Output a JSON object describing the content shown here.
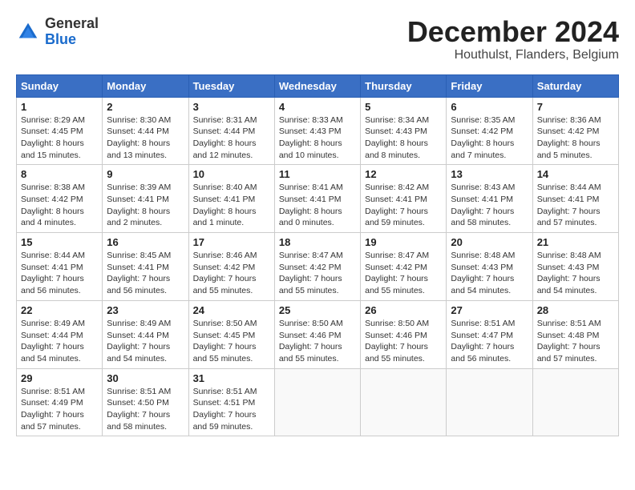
{
  "header": {
    "logo_general": "General",
    "logo_blue": "Blue",
    "month_title": "December 2024",
    "subtitle": "Houthulst, Flanders, Belgium"
  },
  "weekdays": [
    "Sunday",
    "Monday",
    "Tuesday",
    "Wednesday",
    "Thursday",
    "Friday",
    "Saturday"
  ],
  "weeks": [
    [
      {
        "day": "1",
        "info": "Sunrise: 8:29 AM\nSunset: 4:45 PM\nDaylight: 8 hours\nand 15 minutes."
      },
      {
        "day": "2",
        "info": "Sunrise: 8:30 AM\nSunset: 4:44 PM\nDaylight: 8 hours\nand 13 minutes."
      },
      {
        "day": "3",
        "info": "Sunrise: 8:31 AM\nSunset: 4:44 PM\nDaylight: 8 hours\nand 12 minutes."
      },
      {
        "day": "4",
        "info": "Sunrise: 8:33 AM\nSunset: 4:43 PM\nDaylight: 8 hours\nand 10 minutes."
      },
      {
        "day": "5",
        "info": "Sunrise: 8:34 AM\nSunset: 4:43 PM\nDaylight: 8 hours\nand 8 minutes."
      },
      {
        "day": "6",
        "info": "Sunrise: 8:35 AM\nSunset: 4:42 PM\nDaylight: 8 hours\nand 7 minutes."
      },
      {
        "day": "7",
        "info": "Sunrise: 8:36 AM\nSunset: 4:42 PM\nDaylight: 8 hours\nand 5 minutes."
      }
    ],
    [
      {
        "day": "8",
        "info": "Sunrise: 8:38 AM\nSunset: 4:42 PM\nDaylight: 8 hours\nand 4 minutes."
      },
      {
        "day": "9",
        "info": "Sunrise: 8:39 AM\nSunset: 4:41 PM\nDaylight: 8 hours\nand 2 minutes."
      },
      {
        "day": "10",
        "info": "Sunrise: 8:40 AM\nSunset: 4:41 PM\nDaylight: 8 hours\nand 1 minute."
      },
      {
        "day": "11",
        "info": "Sunrise: 8:41 AM\nSunset: 4:41 PM\nDaylight: 8 hours\nand 0 minutes."
      },
      {
        "day": "12",
        "info": "Sunrise: 8:42 AM\nSunset: 4:41 PM\nDaylight: 7 hours\nand 59 minutes."
      },
      {
        "day": "13",
        "info": "Sunrise: 8:43 AM\nSunset: 4:41 PM\nDaylight: 7 hours\nand 58 minutes."
      },
      {
        "day": "14",
        "info": "Sunrise: 8:44 AM\nSunset: 4:41 PM\nDaylight: 7 hours\nand 57 minutes."
      }
    ],
    [
      {
        "day": "15",
        "info": "Sunrise: 8:44 AM\nSunset: 4:41 PM\nDaylight: 7 hours\nand 56 minutes."
      },
      {
        "day": "16",
        "info": "Sunrise: 8:45 AM\nSunset: 4:41 PM\nDaylight: 7 hours\nand 56 minutes."
      },
      {
        "day": "17",
        "info": "Sunrise: 8:46 AM\nSunset: 4:42 PM\nDaylight: 7 hours\nand 55 minutes."
      },
      {
        "day": "18",
        "info": "Sunrise: 8:47 AM\nSunset: 4:42 PM\nDaylight: 7 hours\nand 55 minutes."
      },
      {
        "day": "19",
        "info": "Sunrise: 8:47 AM\nSunset: 4:42 PM\nDaylight: 7 hours\nand 55 minutes."
      },
      {
        "day": "20",
        "info": "Sunrise: 8:48 AM\nSunset: 4:43 PM\nDaylight: 7 hours\nand 54 minutes."
      },
      {
        "day": "21",
        "info": "Sunrise: 8:48 AM\nSunset: 4:43 PM\nDaylight: 7 hours\nand 54 minutes."
      }
    ],
    [
      {
        "day": "22",
        "info": "Sunrise: 8:49 AM\nSunset: 4:44 PM\nDaylight: 7 hours\nand 54 minutes."
      },
      {
        "day": "23",
        "info": "Sunrise: 8:49 AM\nSunset: 4:44 PM\nDaylight: 7 hours\nand 54 minutes."
      },
      {
        "day": "24",
        "info": "Sunrise: 8:50 AM\nSunset: 4:45 PM\nDaylight: 7 hours\nand 55 minutes."
      },
      {
        "day": "25",
        "info": "Sunrise: 8:50 AM\nSunset: 4:46 PM\nDaylight: 7 hours\nand 55 minutes."
      },
      {
        "day": "26",
        "info": "Sunrise: 8:50 AM\nSunset: 4:46 PM\nDaylight: 7 hours\nand 55 minutes."
      },
      {
        "day": "27",
        "info": "Sunrise: 8:51 AM\nSunset: 4:47 PM\nDaylight: 7 hours\nand 56 minutes."
      },
      {
        "day": "28",
        "info": "Sunrise: 8:51 AM\nSunset: 4:48 PM\nDaylight: 7 hours\nand 57 minutes."
      }
    ],
    [
      {
        "day": "29",
        "info": "Sunrise: 8:51 AM\nSunset: 4:49 PM\nDaylight: 7 hours\nand 57 minutes."
      },
      {
        "day": "30",
        "info": "Sunrise: 8:51 AM\nSunset: 4:50 PM\nDaylight: 7 hours\nand 58 minutes."
      },
      {
        "day": "31",
        "info": "Sunrise: 8:51 AM\nSunset: 4:51 PM\nDaylight: 7 hours\nand 59 minutes."
      },
      null,
      null,
      null,
      null
    ]
  ]
}
